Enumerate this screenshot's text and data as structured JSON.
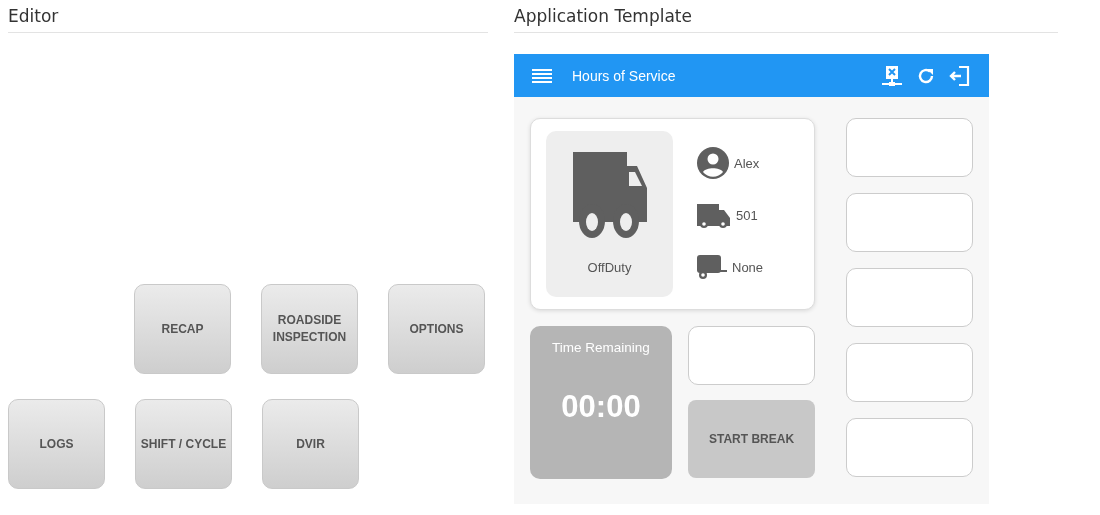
{
  "editor": {
    "title": "Editor",
    "rows": [
      {
        "tiles": [
          "RECAP",
          "ROADSIDE INSPECTION",
          "OPTIONS"
        ]
      },
      {
        "tiles": [
          "LOGS",
          "SHIFT / CYCLE",
          "DVIR"
        ]
      }
    ]
  },
  "template": {
    "title": "Application Template",
    "app_bar": {
      "title": "Hours of Service"
    },
    "status_card": {
      "status": "OffDuty",
      "details": [
        {
          "kind": "driver",
          "text": "Alex"
        },
        {
          "kind": "truck",
          "text": "501"
        },
        {
          "kind": "trailer",
          "text": "None"
        }
      ]
    },
    "timer": {
      "label": "Time Remaining",
      "value": "00:00"
    },
    "break_button": "START BREAK",
    "side_slots": [
      {
        "kind": "empty"
      },
      {
        "kind": "empty"
      },
      {
        "kind": "empty"
      },
      {
        "kind": "empty"
      },
      {
        "kind": "empty"
      }
    ]
  }
}
